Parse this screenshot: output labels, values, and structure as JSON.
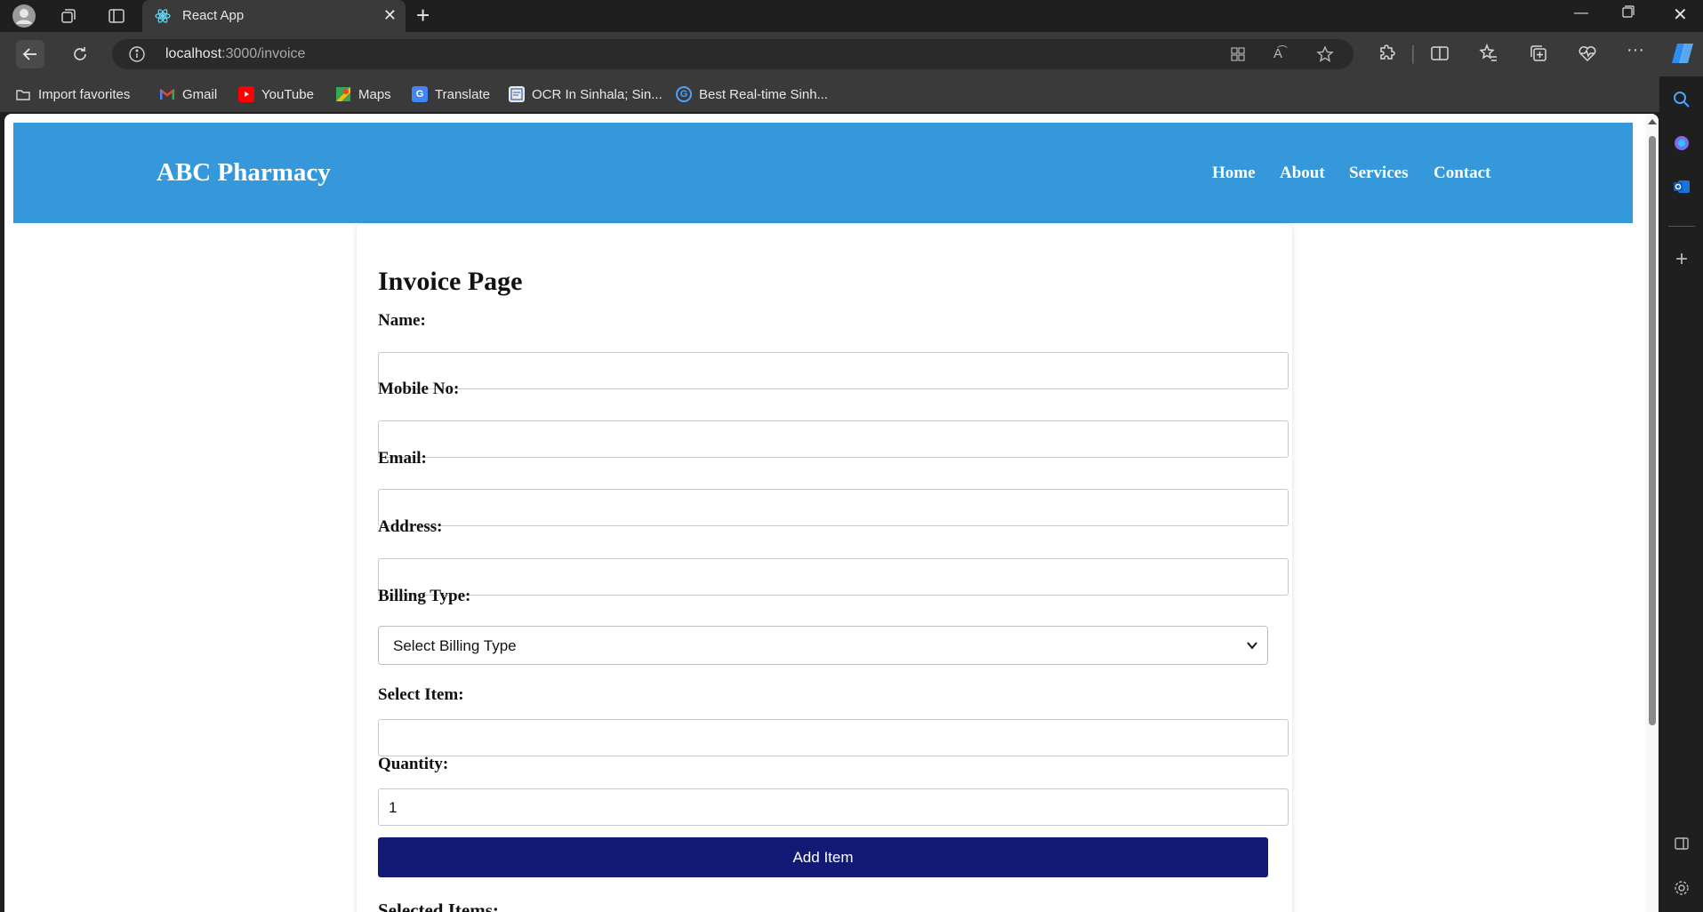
{
  "browser": {
    "tab_title": "React App",
    "url_host": "localhost",
    "url_path": ":3000/invoice",
    "bookmarks": [
      {
        "label": "Import favorites",
        "icon": "folder-import-icon"
      },
      {
        "label": "Gmail",
        "icon": "gmail-icon"
      },
      {
        "label": "YouTube",
        "icon": "youtube-icon"
      },
      {
        "label": "Maps",
        "icon": "maps-icon"
      },
      {
        "label": "Translate",
        "icon": "translate-icon"
      },
      {
        "label": "OCR In Sinhala; Sin...",
        "icon": "ocr-icon"
      },
      {
        "label": "Best Real-time Sinh...",
        "icon": "google-icon"
      }
    ]
  },
  "site": {
    "logo": "ABC Pharmacy",
    "nav": [
      "Home",
      "About",
      "Services",
      "Contact"
    ],
    "header_color": "#3498db"
  },
  "form": {
    "title": "Invoice Page",
    "name_label": "Name:",
    "name_value": "",
    "mobile_label": "Mobile No:",
    "mobile_value": "",
    "email_label": "Email:",
    "email_value": "",
    "address_label": "Address:",
    "address_value": "",
    "billing_label": "Billing Type:",
    "billing_selected": "Select Billing Type",
    "item_label": "Select Item:",
    "item_value": "",
    "quantity_label": "Quantity:",
    "quantity_value": "1",
    "add_button": "Add Item",
    "add_button_color": "#121a75",
    "selected_items_heading": "Selected Items:"
  }
}
